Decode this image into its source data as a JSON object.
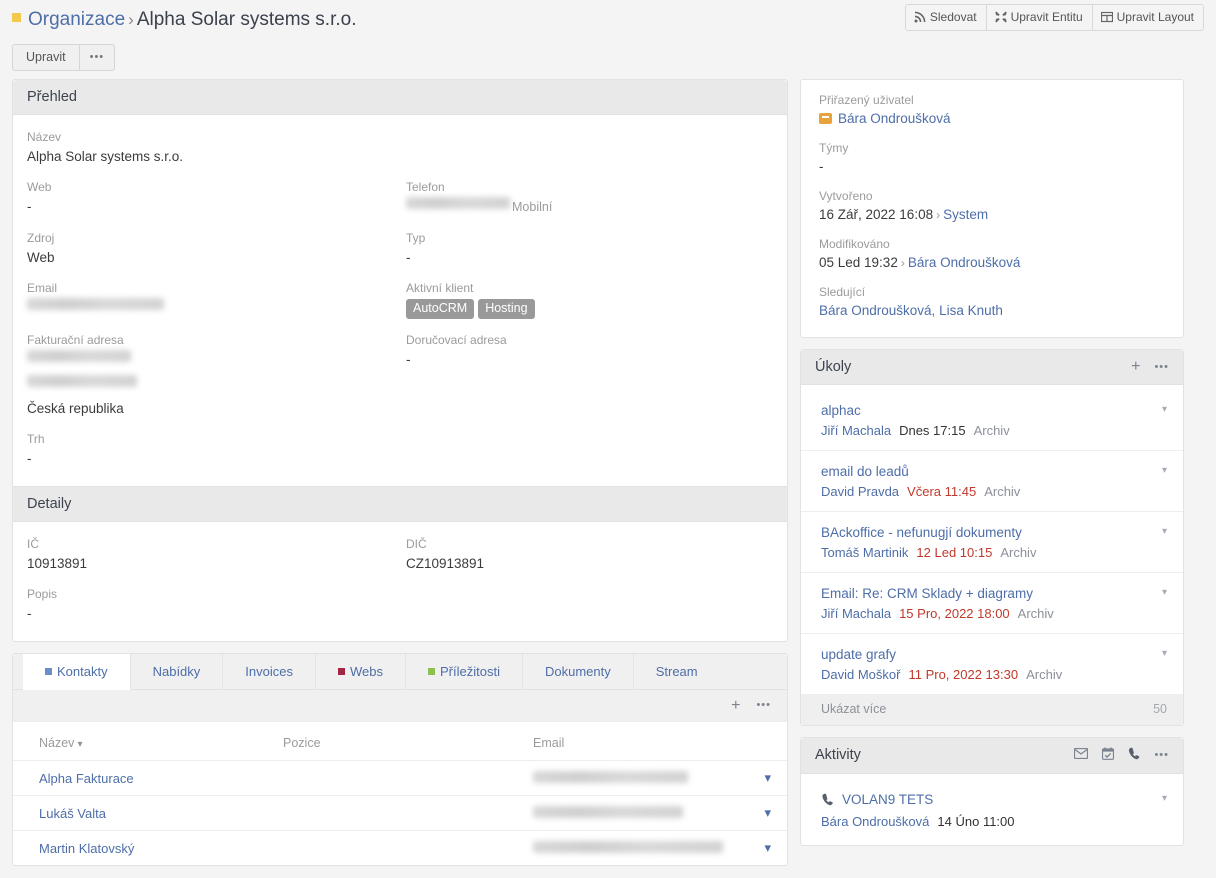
{
  "breadcrumb": {
    "parent": "Organizace",
    "separator": "›",
    "current": "Alpha Solar systems s.r.o.",
    "square_color": "#f2c94c"
  },
  "header_buttons": [
    {
      "label": "Sledovat",
      "icon": "rss-icon"
    },
    {
      "label": "Upravit Entitu",
      "icon": "wrench-icon"
    },
    {
      "label": "Upravit Layout",
      "icon": "layout-grid-icon"
    }
  ],
  "actions": {
    "edit_label": "Upravit",
    "more_label": "•••"
  },
  "overview": {
    "title": "Přehled",
    "fields_left": [
      {
        "label": "Název",
        "value": "Alpha Solar systems s.r.o.",
        "blurred": false
      },
      {
        "label": "Web",
        "value": "-",
        "blurred": false
      },
      {
        "label": "Zdroj",
        "value": "Web",
        "blurred": false
      },
      {
        "label": "Email",
        "value": "",
        "blurred": true,
        "blur_width": 137
      },
      {
        "label": "Fakturační adresa",
        "value": "Česká republika",
        "blurred": false
      }
    ],
    "fields_right": [
      {
        "label": "Telefon",
        "value": "",
        "blurred": true,
        "blur_width": 104,
        "suffix": "Mobilní"
      },
      {
        "label": "Typ",
        "value": "-",
        "blurred": false
      },
      {
        "label": "Aktivní klient",
        "tags": [
          "AutoCRM",
          "Hosting"
        ]
      },
      {
        "label": "Doručovací adresa",
        "value": "-",
        "blurred": false
      }
    ],
    "address_line1_width": 104,
    "address_line2_width": 110,
    "market": {
      "label": "Trh",
      "value": "-"
    }
  },
  "details": {
    "title": "Detaily",
    "fields": [
      {
        "label": "IČ",
        "value": "10913891"
      },
      {
        "label": "DIČ",
        "value": "CZ10913891"
      },
      {
        "label": "Popis",
        "value": "-"
      }
    ]
  },
  "relationship_tabs": [
    {
      "label": "Kontakty",
      "active": true,
      "square": "#6a8fc7"
    },
    {
      "label": "Nabídky",
      "active": false,
      "square": null
    },
    {
      "label": "Invoices",
      "active": false,
      "square": null
    },
    {
      "label": "Webs",
      "active": false,
      "square": "#a32645"
    },
    {
      "label": "Příležitosti",
      "active": false,
      "square": "#8cc04e"
    },
    {
      "label": "Dokumenty",
      "active": false,
      "square": null
    },
    {
      "label": "Stream",
      "active": false,
      "square": null
    }
  ],
  "tabs_toolbar": {
    "add_label": "+",
    "more_label": "•••"
  },
  "contacts_table": {
    "columns": [
      "Název",
      "Pozice",
      "Email"
    ],
    "sort_column": "Název",
    "rows": [
      {
        "name": "Alpha Fakturace",
        "position": "",
        "email_blur_width": 155
      },
      {
        "name": "Lukáš Valta",
        "position": "",
        "email_blur_width": 150
      },
      {
        "name": "Martin Klatovský",
        "position": "",
        "email_blur_width": 190
      }
    ]
  },
  "side_info": {
    "fields": [
      {
        "label": "Přiřazený uživatel",
        "value": "Bára Ondroušková",
        "icon": "user-briefcase-icon",
        "link": true
      },
      {
        "label": "Týmy",
        "value": "-",
        "link": false
      },
      {
        "label": "Vytvořeno",
        "value": "16 Zář, 2022 16:08",
        "sep": "›",
        "by": "System"
      },
      {
        "label": "Modifikováno",
        "value": "05 Led 19:32",
        "sep": "›",
        "by": "Bára Ondroušková"
      },
      {
        "label": "Sledující",
        "value": "Bára Ondroušková, Lisa Knuth",
        "link": true
      }
    ]
  },
  "tasks_panel": {
    "title": "Úkoly",
    "add_label": "+",
    "more_label": "•••",
    "items": [
      {
        "title": "alphac",
        "user": "Jiří Machala",
        "date": "Dnes 17:15",
        "overdue": false,
        "status": "Archiv"
      },
      {
        "title": "email do leadů",
        "user": "David Pravda",
        "date": "Včera 11:45",
        "overdue": true,
        "status": "Archiv"
      },
      {
        "title": "BAckoffice - nefunugjí dokumenty",
        "user": "Tomáš Martinik",
        "date": "12 Led 10:15",
        "overdue": true,
        "status": "Archiv"
      },
      {
        "title": "Email: Re: CRM Sklady + diagramy",
        "user": "Jiří Machala",
        "date": "15 Pro, 2022 18:00",
        "overdue": true,
        "status": "Archiv"
      },
      {
        "title": "update grafy",
        "user": "David Moškoř",
        "date": "11 Pro, 2022 13:30",
        "overdue": true,
        "status": "Archiv"
      }
    ],
    "show_more_label": "Ukázat více",
    "total_count": "50"
  },
  "activities_panel": {
    "title": "Aktivity",
    "header_icons": [
      "envelope-icon",
      "calendar-check-icon",
      "phone-icon",
      "ellipsis-icon"
    ],
    "items": [
      {
        "icon": "phone-icon",
        "title": "VOLAN9 TETS",
        "user": "Bára Ondroušková",
        "date": "14 Úno 11:00"
      }
    ]
  }
}
